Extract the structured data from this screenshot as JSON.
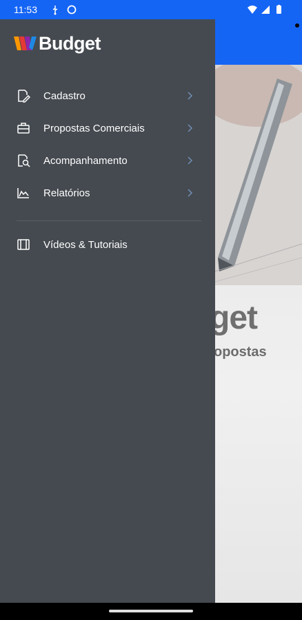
{
  "status_bar": {
    "time": "11:53",
    "icons": [
      "usb-icon",
      "sync-icon",
      "wifi-icon",
      "signal-icon",
      "battery-icon"
    ]
  },
  "app": {
    "brand": "Budget",
    "background_title": "get",
    "background_subtitle": "opostas",
    "accent": "#1565f5",
    "drawer_color": "#454a50"
  },
  "menu": {
    "items": [
      {
        "label": "Cadastro",
        "icon": "edit-document-icon"
      },
      {
        "label": "Propostas Comerciais",
        "icon": "briefcase-icon"
      },
      {
        "label": "Acompanhamento",
        "icon": "document-search-icon"
      },
      {
        "label": "Relatórios",
        "icon": "area-chart-icon"
      }
    ],
    "secondary": {
      "label": "Vídeos & Tutoriais",
      "icon": "video-icon"
    }
  }
}
